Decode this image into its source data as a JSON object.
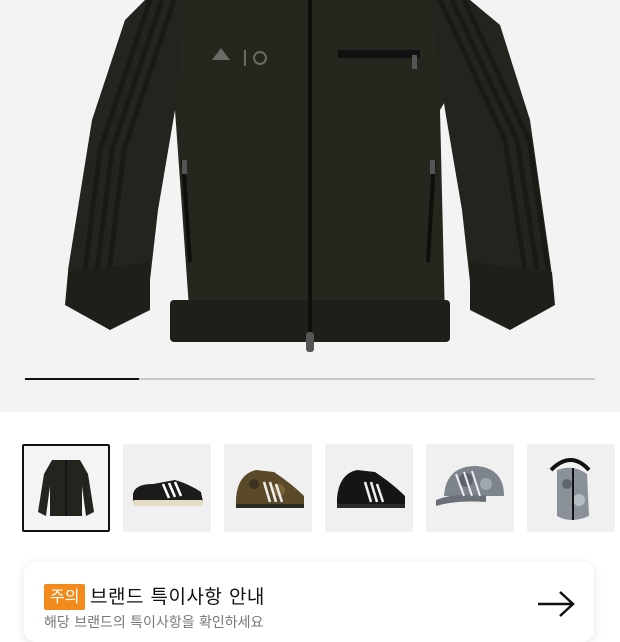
{
  "product_gallery": {
    "image_name": "Black track jacket",
    "slide_progress": 0.2
  },
  "thumbnails": [
    {
      "name": "thumb-jacket",
      "selected": true
    },
    {
      "name": "thumb-sneaker-superstar",
      "selected": false
    },
    {
      "name": "thumb-sneaker-camo",
      "selected": false
    },
    {
      "name": "thumb-sneaker-black",
      "selected": false
    },
    {
      "name": "thumb-cap-camo",
      "selected": false
    },
    {
      "name": "thumb-sling-bag",
      "selected": false
    }
  ],
  "notice": {
    "badge": "주의",
    "title": "브랜드 특이사항 안내",
    "subtitle": "해당 브랜드의 특이사항을 확인하세요",
    "accent_color": "#f28a1c"
  }
}
